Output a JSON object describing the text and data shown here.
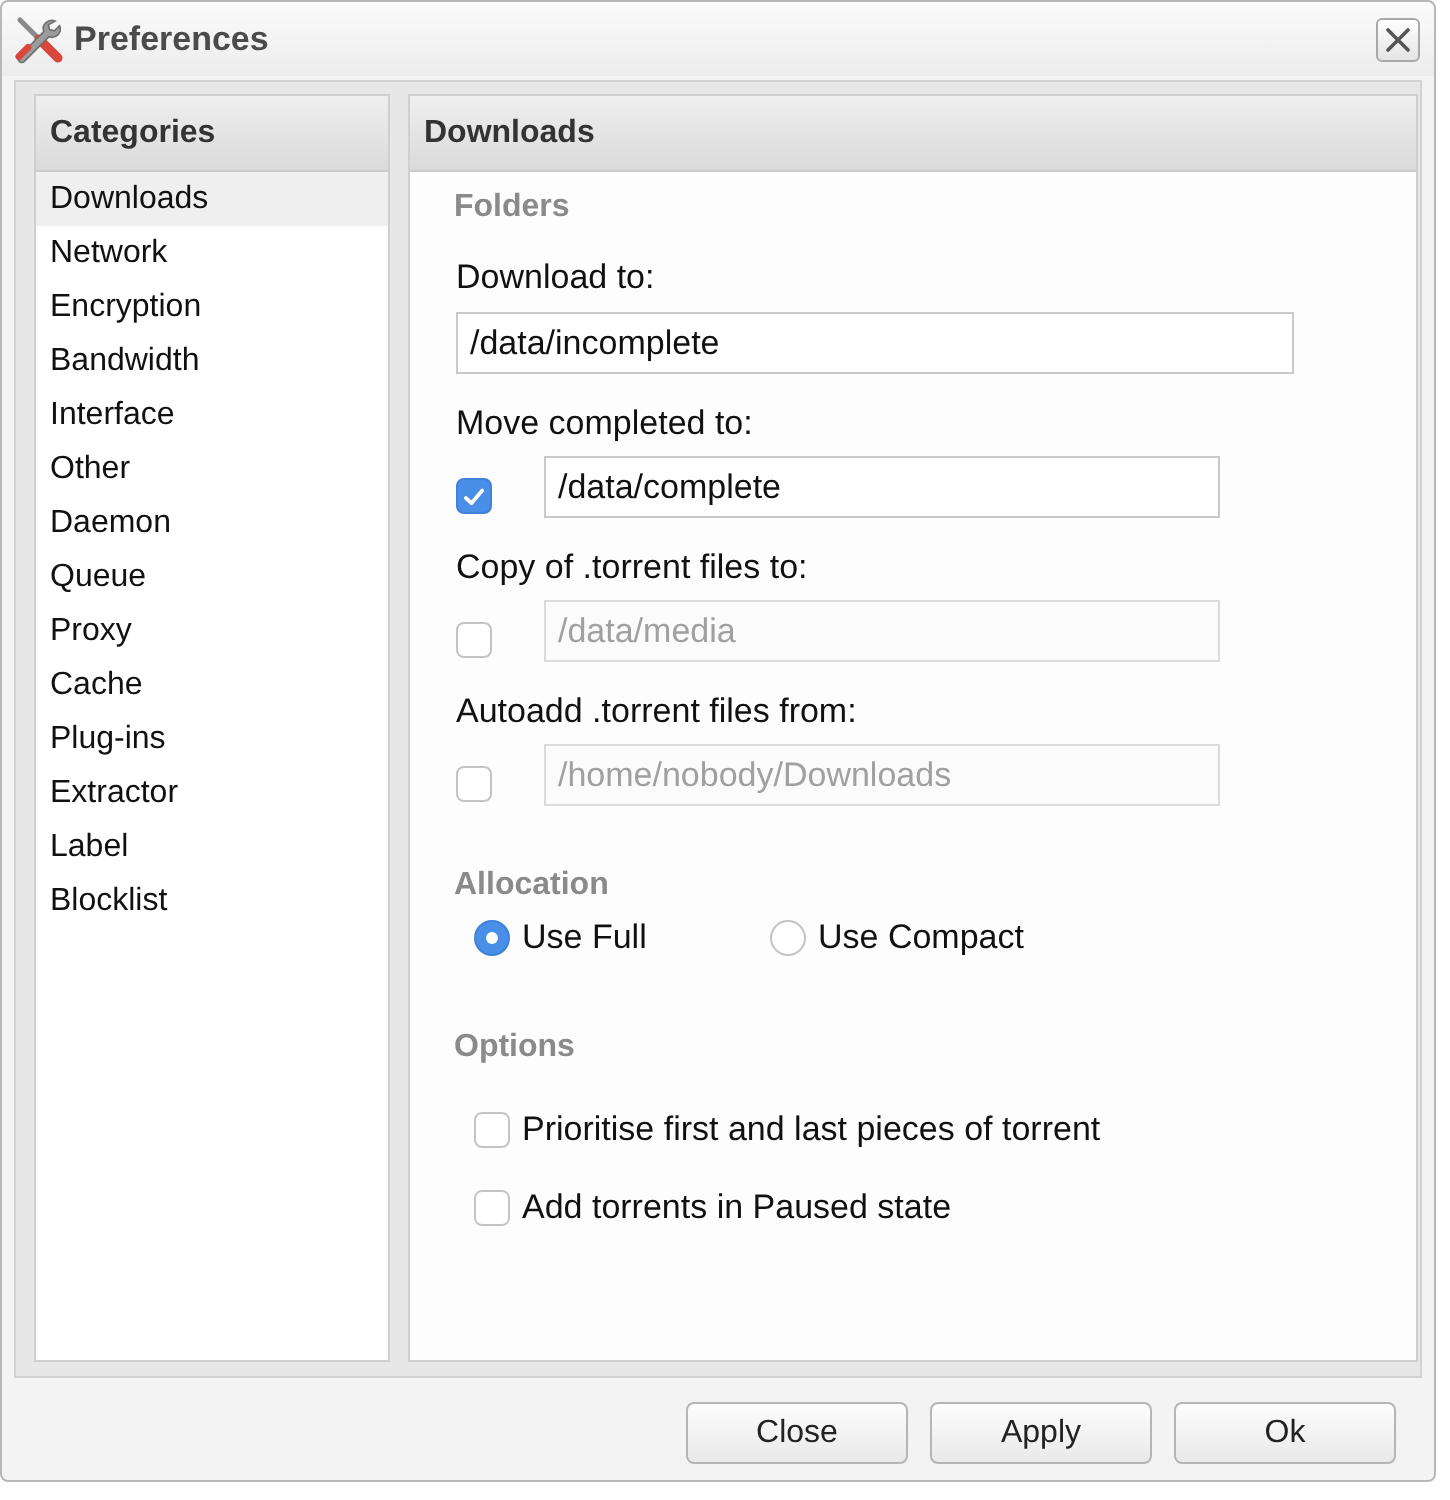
{
  "window": {
    "title": "Preferences"
  },
  "sidebar": {
    "title": "Categories",
    "items": [
      {
        "label": "Downloads",
        "selected": true
      },
      {
        "label": "Network",
        "selected": false
      },
      {
        "label": "Encryption",
        "selected": false
      },
      {
        "label": "Bandwidth",
        "selected": false
      },
      {
        "label": "Interface",
        "selected": false
      },
      {
        "label": "Other",
        "selected": false
      },
      {
        "label": "Daemon",
        "selected": false
      },
      {
        "label": "Queue",
        "selected": false
      },
      {
        "label": "Proxy",
        "selected": false
      },
      {
        "label": "Cache",
        "selected": false
      },
      {
        "label": "Plug-ins",
        "selected": false
      },
      {
        "label": "Extractor",
        "selected": false
      },
      {
        "label": "Label",
        "selected": false
      },
      {
        "label": "Blocklist",
        "selected": false
      }
    ]
  },
  "panel": {
    "title": "Downloads",
    "sections": [
      {
        "title": "Folders",
        "kind": "fields",
        "fields": [
          {
            "kind": "text",
            "label": "Download to:",
            "value": "/data/incomplete",
            "disabled": false
          },
          {
            "kind": "check-text",
            "label": "Move completed to:",
            "checked": true,
            "value": "/data/complete",
            "disabled": false
          },
          {
            "kind": "check-text",
            "label": "Copy of .torrent files to:",
            "checked": false,
            "value": "/data/media",
            "disabled": true
          },
          {
            "kind": "check-text",
            "label": "Autoadd .torrent files from:",
            "checked": false,
            "value": "/home/nobody/Downloads",
            "disabled": true
          }
        ]
      },
      {
        "title": "Allocation",
        "kind": "radio",
        "options": [
          {
            "label": "Use Full",
            "selected": true
          },
          {
            "label": "Use Compact",
            "selected": false
          }
        ]
      },
      {
        "title": "Options",
        "kind": "checks",
        "options": [
          {
            "label": "Prioritise first and last pieces of torrent",
            "checked": false
          },
          {
            "label": "Add torrents in Paused state",
            "checked": false
          }
        ]
      }
    ]
  },
  "buttons": [
    "Close",
    "Apply",
    "Ok"
  ]
}
